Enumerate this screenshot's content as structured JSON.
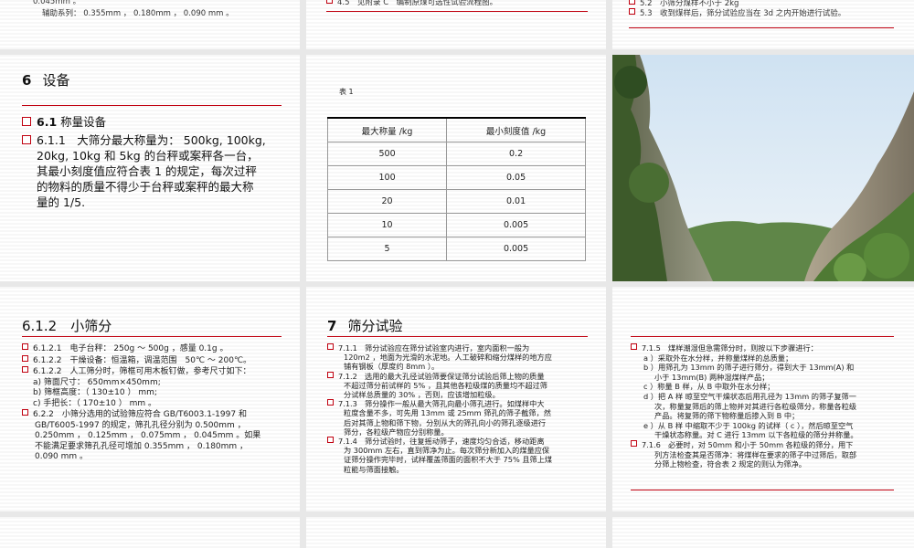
{
  "top_left": {
    "line1": "0.045mm 。",
    "line2": "辅助系列： 0.355mm ， 0.180mm ， 0.090 mm 。"
  },
  "top_middle": {
    "item": "4.5　见附录 C　编制原煤可选性试验流程图。"
  },
  "top_right": {
    "item1": "5.2　小筛分煤样不小于 2kg",
    "item2": "5.3　收到煤样后，筛分试验应当在 3d 之内开始进行试验。"
  },
  "equipment": {
    "section_number": "6",
    "section_title": "设备",
    "sub_number": "6.1",
    "sub_title": "称量设备",
    "para_lines": [
      "6.1.1　大筛分最大称量为： 500kg, 100kg,",
      "20kg, 10kg 和 5kg 的台秤或案秤各一台，",
      "其最小刻度值应符合表 1 的规定，每次过秤",
      "的物料的质量不得少于台秤或案秤的最大称",
      "量的 1/5."
    ]
  },
  "table1": {
    "caption": "表 1",
    "headers": [
      "最大称量 /kg",
      "最小刻度值 /kg"
    ],
    "rows": [
      [
        "500",
        "0.2"
      ],
      [
        "100",
        "0.05"
      ],
      [
        "20",
        "0.01"
      ],
      [
        "10",
        "0.005"
      ],
      [
        "5",
        "0.005"
      ]
    ]
  },
  "photo": {
    "sky_color": "#d9e8f4",
    "rock_color": "#8a8a78",
    "green_color": "#3f6e2a"
  },
  "small_sieve": {
    "title_number": "6.1.2",
    "title_text": "小筛分",
    "items": [
      {
        "bullet": true,
        "text": "6.1.2.1　电子台秤： 250g ～ 500g ，感量 0.1g 。"
      },
      {
        "bullet": true,
        "text": "6.1.2.2　干燥设备：恒温箱，调温范围　50℃ ～ 200℃。"
      },
      {
        "bullet": true,
        "text": "6.1.2.2　人工筛分时，筛框可用木板钉做，参考尺寸如下："
      },
      {
        "bullet": false,
        "text": "a)  筛面尺寸： 650mm×450mm;"
      },
      {
        "bullet": false,
        "text": "b)  筛框高度：（ 130±10 ） mm;"
      },
      {
        "bullet": false,
        "text": "c)  手把长：（ 170±10 ） mm 。"
      },
      {
        "bullet": true,
        "text": "6.2.2　小筛分选用的试验筛应符合 GB/T6003.1-1997 和"
      },
      {
        "bullet": false,
        "text": "GB/T6005-1997 的规定，筛孔孔径分别为 0.500mm ，"
      },
      {
        "bullet": false,
        "text": "0.250mm ， 0.125mm ， 0.075mm ， 0.045mm 。如果"
      },
      {
        "bullet": false,
        "text": "不能满足要求筛孔孔径可增加 0.355mm ， 0.180mm ，"
      },
      {
        "bullet": false,
        "text": "0.090 mm 。"
      }
    ]
  },
  "sieve_test": {
    "section_number": "7",
    "section_title": "筛分试验",
    "paras": [
      [
        "7.1.1　筛分试验应在筛分试验室内进行，室内面积一般为",
        "120m2 ，地面为光滑的水泥地。人工破碎和缩分煤样的地方应",
        "铺有钢板（厚度约 8mm ）。"
      ],
      [
        "7.1.2　选用的最大孔径试验筛要保证筛分试验后筛上物的质量",
        "不超过筛分前试样的 5% ，且其他各粒级煤的质量均不超过筛",
        "分试样总质量的 30% ，否则，应该增加粒级。"
      ],
      [
        "7.1.3　筛分操作一般从最大筛孔向最小筛孔进行。如煤样中大",
        "粒度含量不多，可先用 13mm 或 25mm 筛孔的筛子截筛，然",
        "后对其筛上物和筛下物，分别从大的筛孔向小的筛孔逐级进行",
        "筛分，各粒级产物应分别称量。"
      ],
      [
        "7.1.4　筛分试验时，往复摇动筛子，速度均匀合适，移动距离",
        "为 300mm 左右，直到筛净为止。每次筛分新加入的煤量应保",
        "证筛分操作完毕时，试样覆盖筛面的面积不大于 75% 且筛上煤",
        "粒能与筛面接触。"
      ]
    ]
  },
  "steps": {
    "lines": [
      {
        "bullet": true,
        "text": "7.1.5　煤样潮湿但急需筛分时，则按以下步骤进行："
      },
      {
        "bullet": false,
        "text": "a ）采取外在水分样，并称量煤样的总质量；"
      },
      {
        "bullet": false,
        "text": "b ）用筛孔为 13mm  的筛子进行筛分，得到大于 13mm(A) 和"
      },
      {
        "bullet": false,
        "text": "小于 13mm(B) 两种湿煤样产品；"
      },
      {
        "bullet": false,
        "text": "c ）称量 B 样，从 B 中取外在水分样；"
      },
      {
        "bullet": false,
        "text": "d ）把 A 样 晾至空气干燥状态后用孔径为 13mm 的筛子复筛一"
      },
      {
        "bullet": false,
        "text": "次，称量复筛后的筛上物并对其进行各粒级筛分，称量各粒级"
      },
      {
        "bullet": false,
        "text": "产品。将复筛的筛下物称量后掺入到 B 中；"
      },
      {
        "bullet": false,
        "text": "e ）从 B 样 中缩取不少于 100kg 的试样（ c ），然后晾至空气"
      },
      {
        "bullet": false,
        "text": "干燥状态称量。对 C 进行 13mm  以下各粒级的筛分并称量。"
      },
      {
        "bullet": true,
        "text": "7.1.6　必要时，对 50mm  和小于 50mm 各粒级的筛分，用下"
      },
      {
        "bullet": false,
        "text": "列方法检查其是否筛净：将煤样在要求的筛子中过筛后，取部"
      },
      {
        "bullet": false,
        "text": "分筛上物检查，符合表 2  规定的则认为筛净。"
      }
    ]
  }
}
